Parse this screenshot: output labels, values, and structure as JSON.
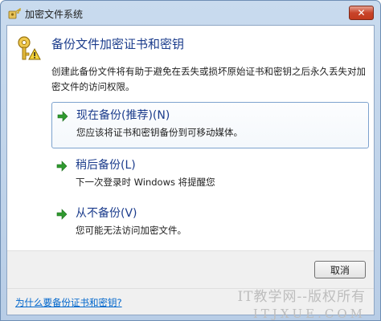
{
  "window": {
    "title": "加密文件系统",
    "close_glyph": "✕"
  },
  "header": {
    "title": "备份文件加密证书和密钥",
    "description": "创建此备份文件将有助于避免在丢失或损坏原始证书和密钥之后永久丢失对加密文件的访问权限。"
  },
  "options": [
    {
      "title": "现在备份(推荐)(N)",
      "subtitle": "您应该将证书和密钥备份到可移动媒体。",
      "focused": true
    },
    {
      "title": "稍后备份(L)",
      "subtitle": "下一次登录时 Windows 将提醒您",
      "focused": false
    },
    {
      "title": "从不备份(V)",
      "subtitle": "您可能无法访问加密文件。",
      "focused": false
    }
  ],
  "footer": {
    "cancel_label": "取消",
    "help_link": "为什么要备份证书和密钥?"
  },
  "watermark": {
    "line1": "IT教学网--版权所有",
    "line2": "ITJXUE.COM"
  },
  "colors": {
    "accent_text": "#1b3c8c",
    "link": "#0066cc",
    "arrow_green": "#2f9a2f"
  },
  "icons": {
    "title": "key-lock-icon",
    "header": "key-lock-icon",
    "option": "green-arrow-icon"
  }
}
